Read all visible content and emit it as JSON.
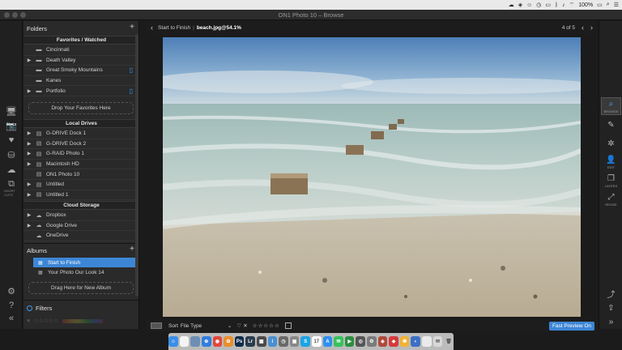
{
  "menubar": {
    "icons": [
      "wifi-icon",
      "battery-icon",
      "search-icon",
      "list-icon"
    ],
    "battery_percent": "100%"
  },
  "window": {
    "title": "ON1 Photo 10 – Browse"
  },
  "sidebar_tools": [
    {
      "name": "computer-icon",
      "glyph": "🖥",
      "caption": ""
    },
    {
      "name": "camera-icon",
      "glyph": "📷",
      "caption": ""
    },
    {
      "name": "heart-folder-icon",
      "glyph": "♥",
      "caption": ""
    },
    {
      "name": "drive-icon",
      "glyph": "⛁",
      "caption": ""
    },
    {
      "name": "cloud-icon",
      "glyph": "☁",
      "caption": ""
    },
    {
      "name": "shortcuts-icon",
      "glyph": "⧉",
      "caption": "SHORT CUTS"
    }
  ],
  "browser": {
    "folders_title": "Folders",
    "favorites_header": "Favorites / Watched",
    "favorites": [
      {
        "label": "Cincinnati",
        "arrow": "",
        "device": ""
      },
      {
        "label": "Death Valley",
        "arrow": "▶",
        "device": ""
      },
      {
        "label": "Great Smoky Mountains",
        "arrow": "",
        "device": "▯"
      },
      {
        "label": "Kanes",
        "arrow": "",
        "device": ""
      },
      {
        "label": "Portfolio",
        "arrow": "▶",
        "device": "▯"
      }
    ],
    "drop_favorites": "Drop Your Favorites Here",
    "local_header": "Local Drives",
    "drives": [
      {
        "label": "G-DRIVE Dock 1",
        "arrow": "▶"
      },
      {
        "label": "G-DRIVE Dock 2",
        "arrow": "▶"
      },
      {
        "label": "G-RAID Photo 1",
        "arrow": "▶"
      },
      {
        "label": "Macintosh HD",
        "arrow": "▶"
      },
      {
        "label": "ON1 Photo 10",
        "arrow": ""
      },
      {
        "label": "Untitled",
        "arrow": "▶"
      },
      {
        "label": "Untitled 1",
        "arrow": "▶"
      }
    ],
    "cloud_header": "Cloud Storage",
    "cloud": [
      {
        "label": "Dropbox",
        "arrow": "▶"
      },
      {
        "label": "Google Drive",
        "arrow": "▶"
      },
      {
        "label": "OneDrive",
        "arrow": ""
      }
    ],
    "albums_title": "Albums",
    "albums": [
      {
        "label": "Start to Finish",
        "selected": true
      },
      {
        "label": "Your Photo Our Look 14",
        "selected": false
      }
    ],
    "drop_album": "Drag Here for New Album",
    "filters_title": "Filters"
  },
  "pathbar": {
    "album": "Start to Finish",
    "separator": "|",
    "file": "beach.jpg@54.1%",
    "counter": "4 of 5"
  },
  "bottombar": {
    "sort_label": "Sort",
    "sort_value": "File Type",
    "stars": "☆☆☆☆☆",
    "fast_preview": "Fast Preview On"
  },
  "right_tools": [
    {
      "name": "browse-icon",
      "glyph": "⌕",
      "caption": "BROWSE",
      "active": true
    },
    {
      "name": "develop-icon",
      "glyph": "✎",
      "caption": "",
      "active": false
    },
    {
      "name": "effects-icon",
      "glyph": "✲",
      "caption": "",
      "active": false
    },
    {
      "name": "portrait-icon",
      "glyph": "👤",
      "caption": "EDIT",
      "active": false
    },
    {
      "name": "layers-icon",
      "glyph": "❐",
      "caption": "LAYERS",
      "active": false
    },
    {
      "name": "resize-icon",
      "glyph": "⤢",
      "caption": "RESIZE",
      "active": false
    }
  ],
  "dock": [
    {
      "name": "finder-icon",
      "color": "#3b8fe8",
      "glyph": "☺"
    },
    {
      "name": "notes-icon",
      "color": "#f4f4f4",
      "glyph": ""
    },
    {
      "name": "preview-icon",
      "color": "#6d8fb5",
      "glyph": ""
    },
    {
      "name": "safari-icon",
      "color": "#2f7fe0",
      "glyph": "⊕"
    },
    {
      "name": "chrome-icon",
      "color": "#e2473b",
      "glyph": "◉"
    },
    {
      "name": "photos-icon",
      "color": "#e88f2d",
      "glyph": "✿"
    },
    {
      "name": "photoshop-icon",
      "color": "#0f2b4a",
      "glyph": "Ps"
    },
    {
      "name": "lightroom-icon",
      "color": "#2a3b4d",
      "glyph": "Lr"
    },
    {
      "name": "gallery-icon",
      "color": "#4a4a4a",
      "glyph": "▦"
    },
    {
      "name": "info-icon",
      "color": "#4a8fd0",
      "glyph": "i"
    },
    {
      "name": "clock-icon",
      "color": "#6a6a6a",
      "glyph": "◷"
    },
    {
      "name": "photo-app-icon",
      "color": "#888",
      "glyph": "▣"
    },
    {
      "name": "skype-icon",
      "color": "#1aa3e8",
      "glyph": "S"
    },
    {
      "name": "calendar-icon",
      "color": "#ffffff",
      "glyph": "17"
    },
    {
      "name": "appstore-icon",
      "color": "#2d8ff0",
      "glyph": "A"
    },
    {
      "name": "messages-icon",
      "color": "#37c25d",
      "glyph": "✉"
    },
    {
      "name": "facetime-icon",
      "color": "#2c8f3f",
      "glyph": "▶"
    },
    {
      "name": "dial-icon",
      "color": "#555",
      "glyph": "◎"
    },
    {
      "name": "preferences-icon",
      "color": "#7b7b7b",
      "glyph": "⚙"
    },
    {
      "name": "palette-icon",
      "color": "#b04a3b",
      "glyph": "◈"
    },
    {
      "name": "on1-icon",
      "color": "#d63a3a",
      "glyph": "◆"
    },
    {
      "name": "sparkle-icon",
      "color": "#f2b233",
      "glyph": "✺"
    },
    {
      "name": "screen-icon",
      "color": "#3b6fc4",
      "glyph": "◐"
    },
    {
      "name": "doc-icon",
      "color": "#eaeaea",
      "glyph": ""
    },
    {
      "name": "mail-icon",
      "color": "#d8d8d8",
      "glyph": "✉"
    },
    {
      "name": "trash-icon",
      "color": "#bcbcbc",
      "glyph": "🗑"
    }
  ],
  "colors": {
    "accent": "#3d86d6",
    "fast_preview_bg": "#3d86d6",
    "device_icon": "#2f9bff"
  }
}
